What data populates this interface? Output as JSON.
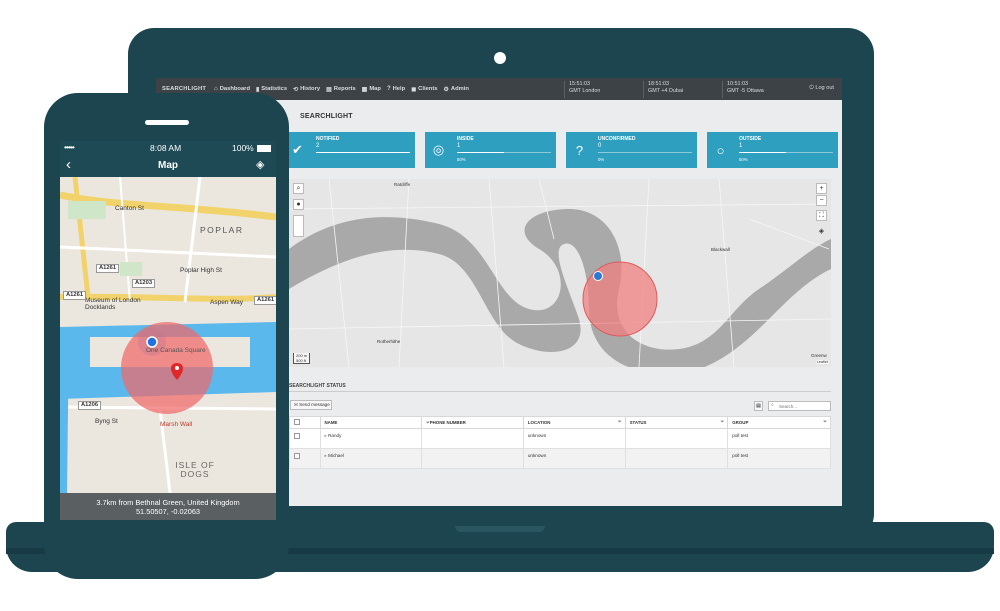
{
  "laptop": {
    "nav": {
      "brand": "SEARCHLIGHT",
      "items": [
        {
          "label": "Dashboard",
          "icon": "home-icon"
        },
        {
          "label": "Statistics",
          "icon": "chart-icon"
        },
        {
          "label": "History",
          "icon": "history-icon"
        },
        {
          "label": "Reports",
          "icon": "report-icon"
        },
        {
          "label": "Map",
          "icon": "map-icon"
        },
        {
          "label": "Help",
          "icon": "help-icon"
        },
        {
          "label": "Clients",
          "icon": "clients-icon"
        },
        {
          "label": "Admin",
          "icon": "admin-icon"
        }
      ],
      "clocks": [
        {
          "time": "15:51:03",
          "zone": "GMT London"
        },
        {
          "time": "18:51:03",
          "zone": "GMT +4 Dubai"
        },
        {
          "time": "10:51:03",
          "zone": "GMT -5 Ottawa"
        }
      ],
      "logout": "Log out"
    },
    "page_title": "SEARCHLIGHT",
    "cards": [
      {
        "label": "NOTIFIED",
        "count": "2",
        "percent": "",
        "fill": 1.0,
        "icon": "check-icon"
      },
      {
        "label": "INSIDE",
        "count": "1",
        "percent": "50%",
        "fill": 0.5,
        "icon": "target-icon"
      },
      {
        "label": "UNCONFIRMED",
        "count": "0",
        "percent": "0%",
        "fill": 0.0,
        "icon": "question-icon"
      },
      {
        "label": "OUTSIDE",
        "count": "1",
        "percent": "50%",
        "fill": 0.5,
        "icon": "circle-icon"
      }
    ],
    "map": {
      "zoom_in": "+",
      "zoom_out": "−",
      "scale_m": "200 m",
      "scale_ft": "500 ft",
      "attribution": "Leaflet",
      "place_labels": [
        "Ratcliffe",
        "Blackwall",
        "Rotherhithe",
        "Greenw"
      ]
    },
    "status": {
      "title": "SEARCHLIGHT STATUS",
      "send_button": "Send message",
      "search_placeholder": "Search...",
      "columns": [
        "NAME",
        "PHONE NUMBER",
        "LOCATION",
        "STATUS",
        "GROUP"
      ],
      "rows": [
        {
          "name": "Randy",
          "phone": "",
          "location": "unknown",
          "status": "",
          "group": "poll test"
        },
        {
          "name": "Michael",
          "phone": "",
          "location": "unknown",
          "status": "",
          "group": "poll test"
        }
      ]
    },
    "colors": {
      "frame": "#1d4550",
      "card": "#2e9fbf",
      "nav": "#3d4247"
    }
  },
  "phone": {
    "status_bar": {
      "signal": "•••••",
      "time": "8:08 AM",
      "battery": "100%"
    },
    "title": "Map",
    "map_labels": [
      "Canton St",
      "POPLAR",
      "Poplar High St",
      "Aspen Way",
      "Museum of London Docklands",
      "One Canada Square",
      "Marsh Wall",
      "Byng St",
      "ISLE OF DOGS"
    ],
    "road_labels": [
      "A1261",
      "A1203",
      "A1261",
      "A1206",
      "A1261"
    ],
    "info_line1": "3.7km from Bethnal Green, United Kingdom",
    "info_line2": "51.50507, -0.02063"
  }
}
